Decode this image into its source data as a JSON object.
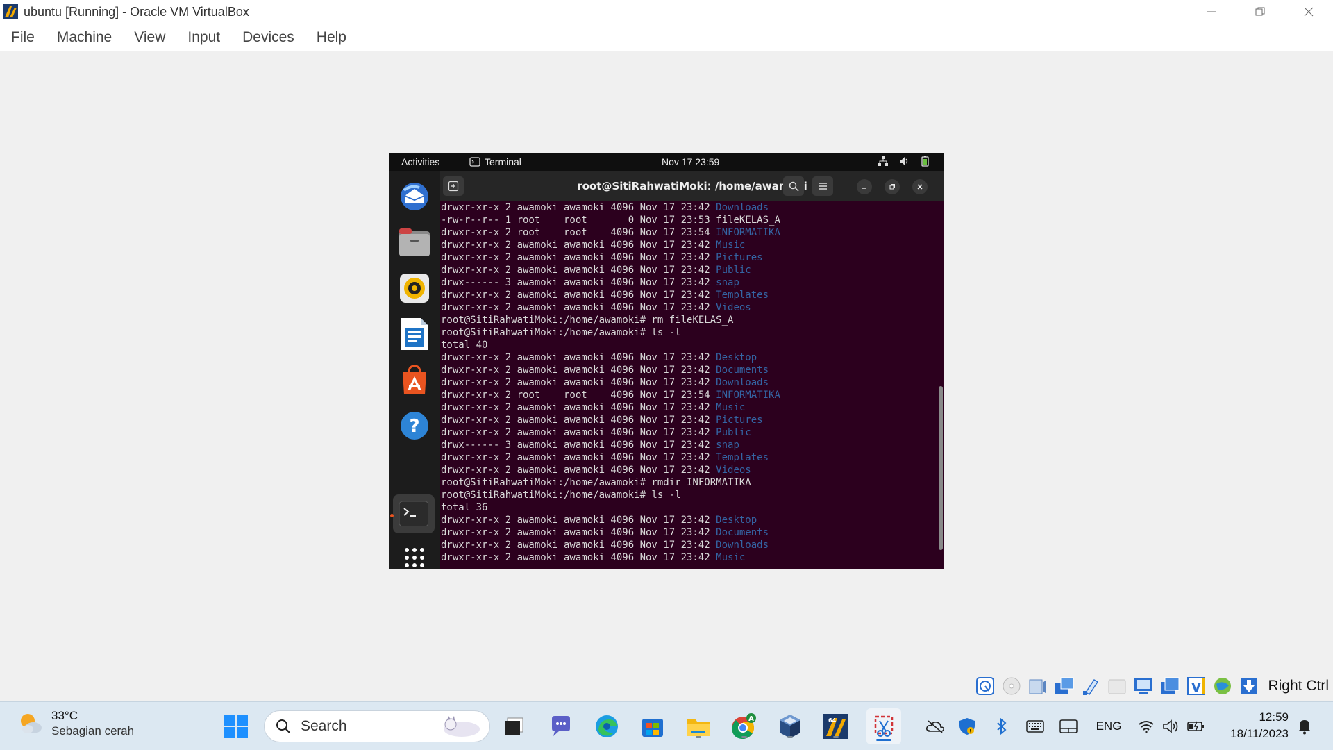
{
  "window": {
    "title": "ubuntu [Running] - Oracle VM VirtualBox",
    "menu": [
      "File",
      "Machine",
      "View",
      "Input",
      "Devices",
      "Help"
    ]
  },
  "guest": {
    "topbar": {
      "activities": "Activities",
      "app": "Terminal",
      "clock": "Nov 17  23:59"
    },
    "terminal": {
      "title": "root@SitiRahwatiMoki: /home/awamoki",
      "lines": [
        {
          "text": "drwxr-xr-x 2 awamoki awamoki 4096 Nov 17 23:42 ",
          "name": "Downloads",
          "dir": true
        },
        {
          "text": "-rw-r--r-- 1 root    root       0 Nov 17 23:53 ",
          "name": "fileKELAS_A",
          "dir": false
        },
        {
          "text": "drwxr-xr-x 2 root    root    4096 Nov 17 23:54 ",
          "name": "INFORMATIKA",
          "dir": true
        },
        {
          "text": "drwxr-xr-x 2 awamoki awamoki 4096 Nov 17 23:42 ",
          "name": "Music",
          "dir": true
        },
        {
          "text": "drwxr-xr-x 2 awamoki awamoki 4096 Nov 17 23:42 ",
          "name": "Pictures",
          "dir": true
        },
        {
          "text": "drwxr-xr-x 2 awamoki awamoki 4096 Nov 17 23:42 ",
          "name": "Public",
          "dir": true
        },
        {
          "text": "drwx------ 3 awamoki awamoki 4096 Nov 17 23:42 ",
          "name": "snap",
          "dir": true
        },
        {
          "text": "drwxr-xr-x 2 awamoki awamoki 4096 Nov 17 23:42 ",
          "name": "Templates",
          "dir": true
        },
        {
          "text": "drwxr-xr-x 2 awamoki awamoki 4096 Nov 17 23:42 ",
          "name": "Videos",
          "dir": true
        },
        {
          "text": "root@SitiRahwatiMoki:/home/awamoki# rm fileKELAS_A",
          "name": "",
          "dir": false
        },
        {
          "text": "root@SitiRahwatiMoki:/home/awamoki# ls -l",
          "name": "",
          "dir": false
        },
        {
          "text": "total 40",
          "name": "",
          "dir": false
        },
        {
          "text": "drwxr-xr-x 2 awamoki awamoki 4096 Nov 17 23:42 ",
          "name": "Desktop",
          "dir": true
        },
        {
          "text": "drwxr-xr-x 2 awamoki awamoki 4096 Nov 17 23:42 ",
          "name": "Documents",
          "dir": true
        },
        {
          "text": "drwxr-xr-x 2 awamoki awamoki 4096 Nov 17 23:42 ",
          "name": "Downloads",
          "dir": true
        },
        {
          "text": "drwxr-xr-x 2 root    root    4096 Nov 17 23:54 ",
          "name": "INFORMATIKA",
          "dir": true
        },
        {
          "text": "drwxr-xr-x 2 awamoki awamoki 4096 Nov 17 23:42 ",
          "name": "Music",
          "dir": true
        },
        {
          "text": "drwxr-xr-x 2 awamoki awamoki 4096 Nov 17 23:42 ",
          "name": "Pictures",
          "dir": true
        },
        {
          "text": "drwxr-xr-x 2 awamoki awamoki 4096 Nov 17 23:42 ",
          "name": "Public",
          "dir": true
        },
        {
          "text": "drwx------ 3 awamoki awamoki 4096 Nov 17 23:42 ",
          "name": "snap",
          "dir": true
        },
        {
          "text": "drwxr-xr-x 2 awamoki awamoki 4096 Nov 17 23:42 ",
          "name": "Templates",
          "dir": true
        },
        {
          "text": "drwxr-xr-x 2 awamoki awamoki 4096 Nov 17 23:42 ",
          "name": "Videos",
          "dir": true
        },
        {
          "text": "root@SitiRahwatiMoki:/home/awamoki# rmdir INFORMATIKA",
          "name": "",
          "dir": false
        },
        {
          "text": "root@SitiRahwatiMoki:/home/awamoki# ls -l",
          "name": "",
          "dir": false
        },
        {
          "text": "total 36",
          "name": "",
          "dir": false
        },
        {
          "text": "drwxr-xr-x 2 awamoki awamoki 4096 Nov 17 23:42 ",
          "name": "Desktop",
          "dir": true
        },
        {
          "text": "drwxr-xr-x 2 awamoki awamoki 4096 Nov 17 23:42 ",
          "name": "Documents",
          "dir": true
        },
        {
          "text": "drwxr-xr-x 2 awamoki awamoki 4096 Nov 17 23:42 ",
          "name": "Downloads",
          "dir": true
        },
        {
          "text": "drwxr-xr-x 2 awamoki awamoki 4096 Nov 17 23:42 ",
          "name": "Music",
          "dir": true
        }
      ]
    },
    "dock": [
      "thunderbird-icon",
      "files-icon",
      "rhythmbox-icon",
      "writer-icon",
      "app-center-icon",
      "help-icon",
      "terminal-icon",
      "app-grid-icon"
    ]
  },
  "vbox_status": {
    "host_key": "Right Ctrl",
    "icons": [
      "hard-disk-icon",
      "optical-drive-icon",
      "audio-icon",
      "network-icon",
      "usb-icon",
      "shared-folder-icon",
      "display-icon",
      "snapshot-icon",
      "recording-icon",
      "cpu-icon",
      "mouse-integration-icon",
      "download-icon"
    ]
  },
  "taskbar": {
    "weather": {
      "temp": "33°C",
      "desc": "Sebagian cerah"
    },
    "search_label": "Search",
    "tray_lang": "ENG",
    "clock_time": "12:59",
    "clock_date": "18/11/2023"
  },
  "colors": {
    "terminal_bg": "#2c001e",
    "dir_blue": "#3465a4",
    "taskbar_bg": "#dce8f2"
  }
}
